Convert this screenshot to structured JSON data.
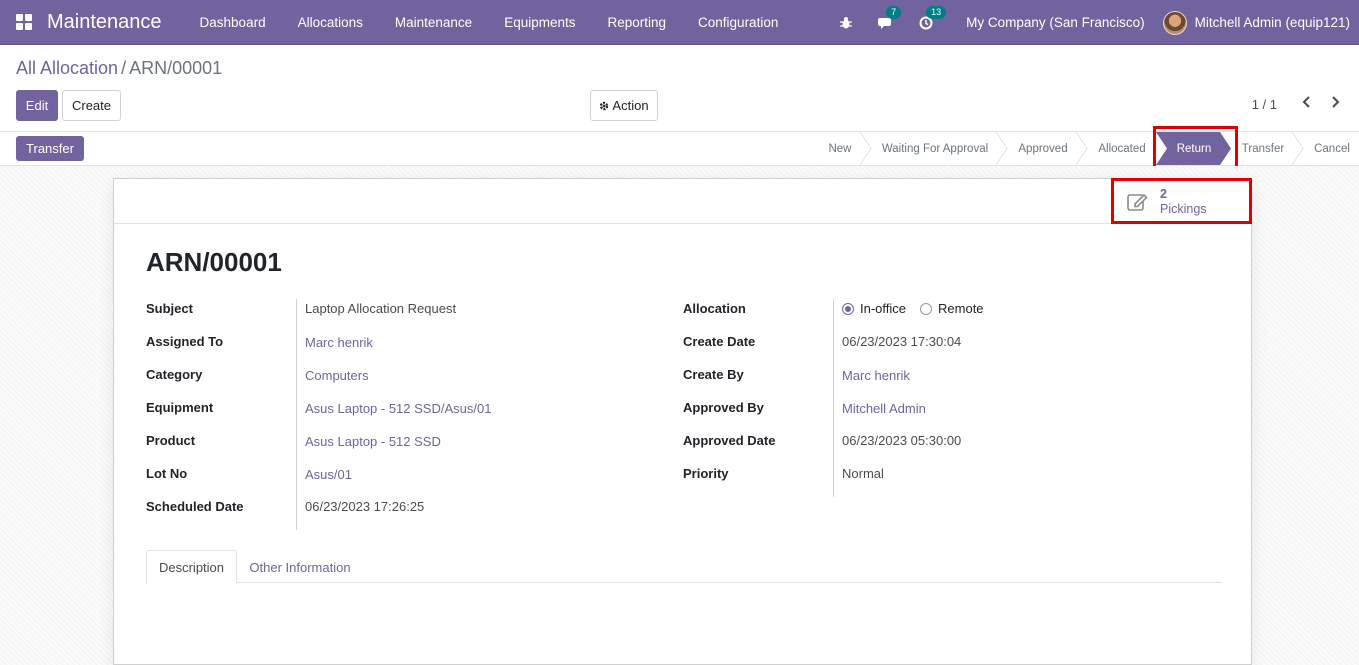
{
  "nav": {
    "app_title": "Maintenance",
    "menu": [
      "Dashboard",
      "Allocations",
      "Maintenance",
      "Equipments",
      "Reporting",
      "Configuration"
    ],
    "messages_badge": "7",
    "activities_badge": "13",
    "company": "My Company (San Francisco)",
    "user": "Mitchell Admin (equip121)"
  },
  "breadcrumb": {
    "parent": "All Allocation",
    "separator": "/",
    "current": "ARN/00001"
  },
  "toolbar": {
    "edit_label": "Edit",
    "create_label": "Create",
    "action_label": "Action",
    "pager": "1 / 1"
  },
  "statusbar": {
    "transfer_label": "Transfer",
    "stages": [
      "New",
      "Waiting For Approval",
      "Approved",
      "Allocated",
      "Return",
      "Transfer",
      "Cancel"
    ],
    "active_stage": "Return"
  },
  "smart_button": {
    "count": "2",
    "label": "Pickings"
  },
  "record": {
    "title": "ARN/00001",
    "left_fields": [
      {
        "label": "Subject",
        "value": "Laptop Allocation Request",
        "link": false
      },
      {
        "label": "Assigned To",
        "value": "Marc henrik",
        "link": true
      },
      {
        "label": "Category",
        "value": "Computers",
        "link": true
      },
      {
        "label": "Equipment",
        "value": "Asus Laptop - 512 SSD/Asus/01",
        "link": true
      },
      {
        "label": "Product",
        "value": "Asus Laptop - 512 SSD",
        "link": true
      },
      {
        "label": "Lot No",
        "value": "Asus/01",
        "link": true
      },
      {
        "label": "Scheduled Date",
        "value": "06/23/2023 17:26:25",
        "link": false
      }
    ],
    "allocation_label": "Allocation",
    "allocation_options": [
      "In-office",
      "Remote"
    ],
    "allocation_selected": "In-office",
    "right_fields": [
      {
        "label": "Create Date",
        "value": "06/23/2023 17:30:04",
        "link": false
      },
      {
        "label": "Create By",
        "value": "Marc henrik",
        "link": true
      },
      {
        "label": "Approved By",
        "value": "Mitchell Admin",
        "link": true
      },
      {
        "label": "Approved Date",
        "value": "06/23/2023 05:30:00",
        "link": false
      },
      {
        "label": "Priority",
        "value": "Normal",
        "link": false
      }
    ]
  },
  "tabs": [
    "Description",
    "Other Information"
  ],
  "colors": {
    "brand": "#71639e",
    "highlight": "#e00000",
    "badge": "#017e84"
  }
}
